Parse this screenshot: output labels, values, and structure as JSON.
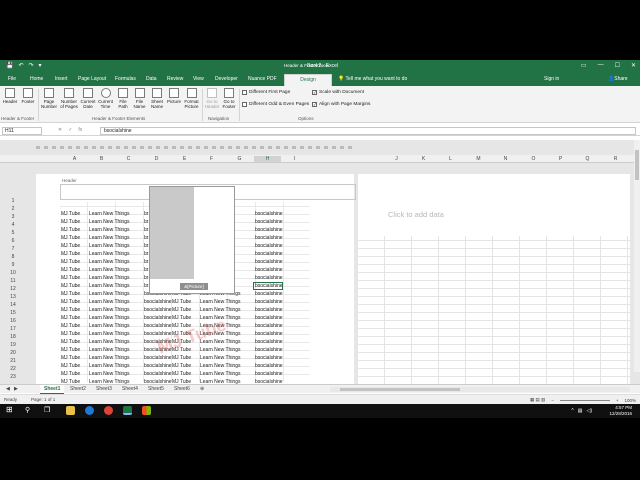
{
  "window": {
    "title": "Book2 - Excel",
    "context_tools": "Header & Footer Tools",
    "qat_save": "💾",
    "qat_undo": "↶",
    "qat_redo": "↷",
    "qat_more": "▾",
    "ribbon_opts": "▭",
    "minimize": "—",
    "maximize": "☐",
    "close": "✕"
  },
  "tabs": [
    "File",
    "Home",
    "Insert",
    "Page Layout",
    "Formulas",
    "Data",
    "Review",
    "View",
    "Developer",
    "Nuance PDF",
    "Design"
  ],
  "tell_me": "Tell me what you want to do",
  "sign_in": "Sign in",
  "share": "Share",
  "ribbon": {
    "buttons": [
      {
        "label": "Header",
        "dim": false
      },
      {
        "label": "Footer",
        "dim": false
      },
      {
        "label": "Page Number",
        "dim": false
      },
      {
        "label": "Number of Pages",
        "dim": false
      },
      {
        "label": "Current Date",
        "dim": false
      },
      {
        "label": "Current Time",
        "dim": false
      },
      {
        "label": "File Path",
        "dim": false
      },
      {
        "label": "File Name",
        "dim": false
      },
      {
        "label": "Sheet Name",
        "dim": false
      },
      {
        "label": "Picture",
        "dim": false
      },
      {
        "label": "Format Picture",
        "dim": false
      },
      {
        "label": "Go to Header",
        "dim": true
      },
      {
        "label": "Go to Footer",
        "dim": false
      }
    ],
    "groups": [
      "Header & Footer",
      "Header & Footer Elements",
      "Navigation",
      "Options"
    ],
    "options": [
      {
        "label": "Different First Page",
        "checked": false
      },
      {
        "label": "Different Odd & Even Pages",
        "checked": false
      },
      {
        "label": "Scale with Document",
        "checked": true
      },
      {
        "label": "Align with Page Margins",
        "checked": true
      }
    ]
  },
  "formula_bar": {
    "name_box": "H11",
    "cancel": "✕",
    "enter": "✓",
    "fx": "fx",
    "content": "bsocialshine"
  },
  "columns_left": [
    "A",
    "B",
    "C",
    "D",
    "E",
    "F",
    "G",
    "H",
    "I"
  ],
  "columns_right": [
    "J",
    "K",
    "L",
    "M",
    "N",
    "O",
    "P",
    "Q",
    "R"
  ],
  "selected_column": "H",
  "page": {
    "header_label": "Header",
    "picture_caption": "&[Picture]",
    "click_to_add": "Click to add data"
  },
  "rows": [
    {
      "n": "1",
      "a": "",
      "b": "",
      "c": "",
      "e": "",
      "g": ""
    },
    {
      "n": "2",
      "a": "MJ Tube",
      "b": "Learn New Things",
      "c": "br",
      "e": "",
      "g": "ngs",
      "h": "bsocialshine"
    },
    {
      "n": "3",
      "a": "MJ Tube",
      "b": "Learn New Things",
      "c": "br",
      "e": "",
      "g": "ngs",
      "h": "bsocialshine"
    },
    {
      "n": "4",
      "a": "MJ Tube",
      "b": "Learn New Things",
      "c": "br",
      "e": "",
      "g": "ngs",
      "h": "bsocialshine"
    },
    {
      "n": "5",
      "a": "MJ Tube",
      "b": "Learn New Things",
      "c": "br",
      "e": "",
      "g": "ngs",
      "h": "bsocialshine"
    },
    {
      "n": "6",
      "a": "MJ Tube",
      "b": "Learn New Things",
      "c": "br",
      "e": "",
      "g": "ngs",
      "h": "bsocialshine"
    },
    {
      "n": "7",
      "a": "MJ Tube",
      "b": "Learn New Things",
      "c": "br",
      "e": "",
      "g": "ngs",
      "h": "bsocialshine"
    },
    {
      "n": "8",
      "a": "MJ Tube",
      "b": "Learn New Things",
      "c": "br",
      "e": "",
      "g": "ngs",
      "h": "bsocialshine"
    },
    {
      "n": "9",
      "a": "MJ Tube",
      "b": "Learn New Things",
      "c": "br",
      "e": "",
      "g": "ngs",
      "h": "bsocialshine"
    },
    {
      "n": "10",
      "a": "MJ Tube",
      "b": "Learn New Things",
      "c": "br",
      "e": "",
      "g": "ngs",
      "h": "bsocialshine"
    },
    {
      "n": "11",
      "a": "MJ Tube",
      "b": "Learn New Things",
      "c": "br",
      "e": "",
      "g": "ngs",
      "h": "bsocialshine"
    },
    {
      "n": "12",
      "a": "MJ Tube",
      "b": "Learn New Things",
      "c": "bsocialshine",
      "e": "MJ Tube",
      "g": "Learn New Things",
      "h": "bsocialshine"
    },
    {
      "n": "13",
      "a": "MJ Tube",
      "b": "Learn New Things",
      "c": "bsocialshine",
      "e": "MJ Tube",
      "g": "Learn New Things",
      "h": "bsocialshine"
    },
    {
      "n": "14",
      "a": "MJ Tube",
      "b": "Learn New Things",
      "c": "bsocialshine",
      "e": "MJ Tube",
      "g": "Learn New Things",
      "h": "bsocialshine"
    },
    {
      "n": "15",
      "a": "MJ Tube",
      "b": "Learn New Things",
      "c": "bsocialshine",
      "e": "MJ Tube",
      "g": "Learn New Things",
      "h": "bsocialshine"
    },
    {
      "n": "16",
      "a": "MJ Tube",
      "b": "Learn New Things",
      "c": "bsocialshine",
      "e": "MJ Tube",
      "g": "Learn New Things",
      "h": "bsocialshine"
    },
    {
      "n": "17",
      "a": "MJ Tube",
      "b": "Learn New Things",
      "c": "bsocialshine",
      "e": "MJ Tube",
      "g": "Learn New Things",
      "h": "bsocialshine"
    },
    {
      "n": "18",
      "a": "MJ Tube",
      "b": "Learn New Things",
      "c": "bsocialshine",
      "e": "MJ Tube",
      "g": "Learn New Things",
      "h": "bsocialshine"
    },
    {
      "n": "19",
      "a": "MJ Tube",
      "b": "Learn New Things",
      "c": "bsocialshine",
      "e": "MJ Tube",
      "g": "Learn New Things",
      "h": "bsocialshine"
    },
    {
      "n": "20",
      "a": "MJ Tube",
      "b": "Learn New Things",
      "c": "bsocialshine",
      "e": "MJ Tube",
      "g": "Learn New Things",
      "h": "bsocialshine"
    },
    {
      "n": "21",
      "a": "MJ Tube",
      "b": "Learn New Things",
      "c": "bsocialshine",
      "e": "MJ Tube",
      "g": "Learn New Things",
      "h": "bsocialshine"
    },
    {
      "n": "22",
      "a": "MJ Tube",
      "b": "Learn New Things",
      "c": "bsocialshine",
      "e": "MJ Tube",
      "g": "Learn New Things",
      "h": "bsocialshine"
    },
    {
      "n": "23",
      "a": "MJ Tube",
      "b": "Learn New Things",
      "c": "bsocialshine",
      "e": "MJ Tube",
      "g": "Learn New Things",
      "h": "bsocialshine"
    }
  ],
  "watermark": "MJ Tube",
  "sheets": [
    "Sheet1",
    "Sheet2",
    "Sheet3",
    "Sheet4",
    "Sheet5",
    "Sheet6"
  ],
  "active_sheet": "Sheet1",
  "status": {
    "ready": "Ready",
    "page": "Page: 1 of 1",
    "zoom": "100%",
    "zoom_minus": "−",
    "zoom_plus": "+",
    "view_icons": "▦ ▤ ▥"
  },
  "taskbar": {
    "start": "⊞",
    "search": "⚲",
    "taskview": "❐",
    "time": "4:57 PM",
    "date": "12/28/2016",
    "tray_up": "^",
    "tray_net": "▤",
    "tray_vol": "◁)"
  },
  "colors": {
    "excel_green": "#217346",
    "ribbon_bg": "#f3f3f3",
    "watermark": "#e63c3c"
  }
}
